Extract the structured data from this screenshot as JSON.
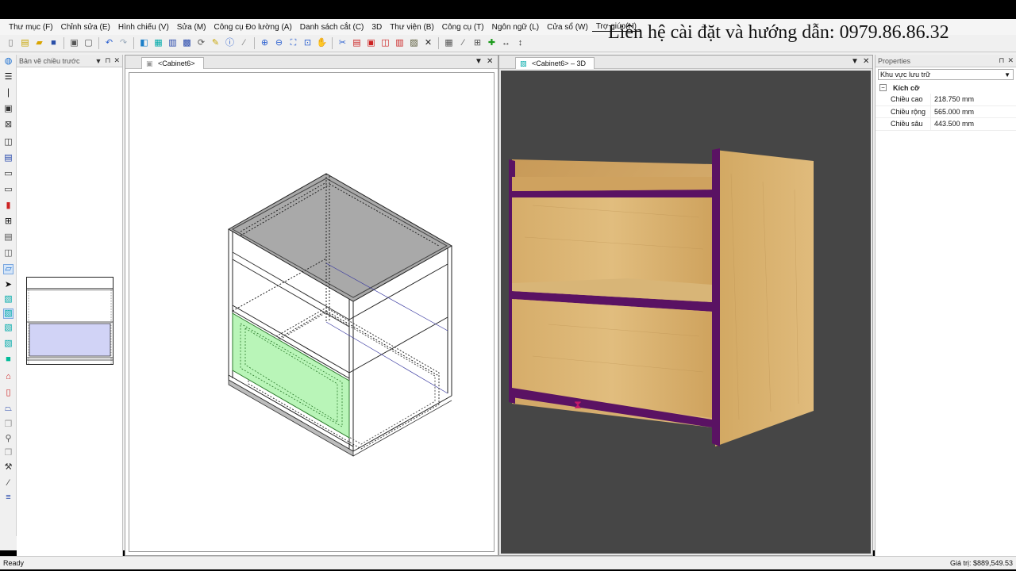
{
  "menu": [
    "Thư mục (F)",
    "Chỉnh sửa (E)",
    "Hình chiếu (V)",
    "Sửa (M)",
    "Công cụ Đo lường (A)",
    "Danh sách cắt (C)",
    "3D",
    "Thư viện (B)",
    "Công cụ (T)",
    "Ngôn ngữ (L)",
    "Cửa sổ (W)",
    "Trợ giúp(H)"
  ],
  "contact_banner": "Liên hệ cài đặt và hướng dẫn: 0979.86.86.32",
  "preview_panel": {
    "title": "Bản vẽ chiều trước"
  },
  "view2d": {
    "tab": "<Cabinet6>"
  },
  "view3d": {
    "tab": "<Cabinet6> – 3D"
  },
  "properties": {
    "title": "Properties",
    "category_selector": "Khu vực lưu trữ",
    "group": "Kích cỡ",
    "rows": [
      {
        "key": "Chiều cao",
        "value": "218.750 mm"
      },
      {
        "key": "Chiều rộng",
        "value": "565.000 mm"
      },
      {
        "key": "Chiều sâu",
        "value": "443.500 mm"
      }
    ]
  },
  "status": {
    "left": "Ready",
    "right": "Giá trị: $889,549.53"
  },
  "colors": {
    "wood": "#d9b06d",
    "edge_band": "#5a1263",
    "drawer_highlight": "#b9f5b8",
    "viewport_bg": "#464646"
  }
}
